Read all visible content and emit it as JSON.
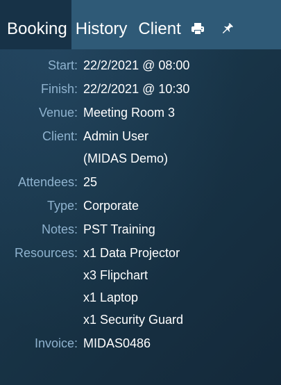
{
  "tabs": {
    "booking": "Booking",
    "history": "History",
    "client": "Client"
  },
  "icons": {
    "print": "printer-icon",
    "pin": "pin-icon"
  },
  "colors": {
    "tab_bar": "#2f5a77",
    "active_tab": "#173247",
    "panel_bg": "#183447",
    "label": "#8fb3cf",
    "value": "#ffffff"
  },
  "booking": {
    "start": {
      "label": "Start:",
      "value": "22/2/2021 @ 08:00"
    },
    "finish": {
      "label": "Finish:",
      "value": "22/2/2021 @ 10:30"
    },
    "venue": {
      "label": "Venue:",
      "value": "Meeting Room 3"
    },
    "client": {
      "label": "Client:",
      "lines": [
        "Admin User",
        "(MIDAS Demo)"
      ]
    },
    "attendees": {
      "label": "Attendees:",
      "value": "25"
    },
    "type": {
      "label": "Type:",
      "value": "Corporate"
    },
    "notes": {
      "label": "Notes:",
      "value": "PST Training"
    },
    "resources": {
      "label": "Resources:",
      "items": [
        "x1 Data Projector",
        "x3 Flipchart",
        "x1 Laptop",
        "x1 Security Guard"
      ]
    },
    "invoice": {
      "label": "Invoice:",
      "value": "MIDAS0486"
    }
  }
}
